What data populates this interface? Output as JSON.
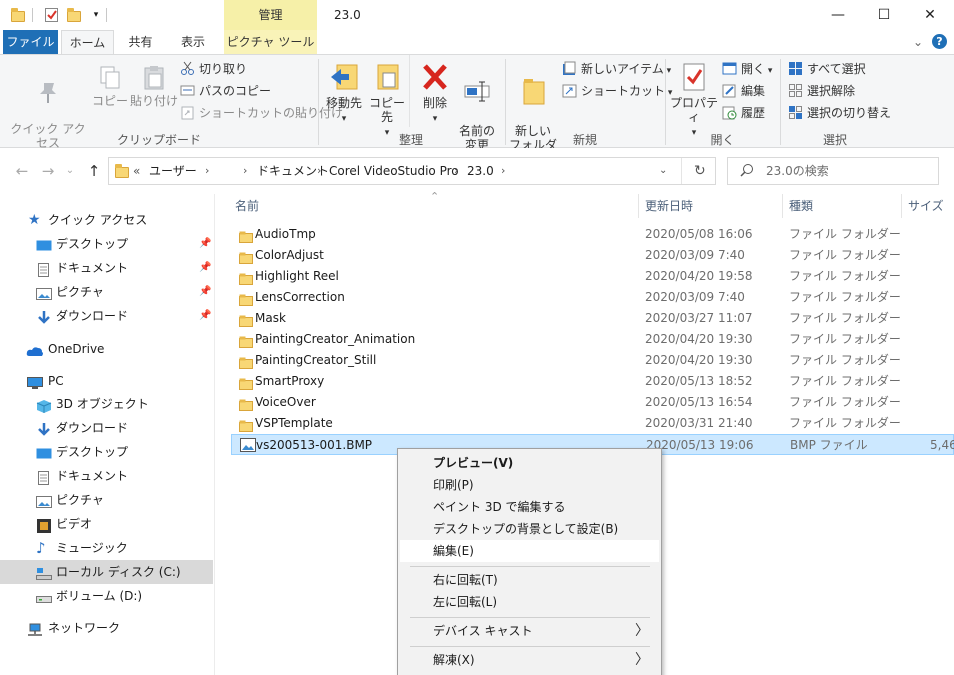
{
  "window": {
    "title": "23.0",
    "manage_tab": "管理",
    "minimize": "—",
    "maximize": "☐",
    "close": "✕"
  },
  "ribbon_tabs": {
    "file": "ファイル",
    "home": "ホーム",
    "share": "共有",
    "view": "表示",
    "picture_tools": "ピクチャ ツール",
    "collapse": "⌄",
    "help": "?"
  },
  "ribbon": {
    "clipboard": {
      "label": "クリップボード",
      "pin_quick_access": "クイック アクセス\nにピン留めする",
      "copy": "コピー",
      "paste": "貼り付け",
      "cut": "切り取り",
      "copy_path": "パスのコピー",
      "paste_shortcut": "ショートカットの貼り付け"
    },
    "organize": {
      "label": "整理",
      "move_to": "移動先",
      "copy_to": "コピー先",
      "delete": "削除",
      "rename": "名前の\n変更"
    },
    "new": {
      "label": "新規",
      "new_folder": "新しい\nフォルダー",
      "new_item": "新しいアイテム",
      "shortcut": "ショートカット"
    },
    "open": {
      "label": "開く",
      "properties": "プロパティ",
      "open": "開く",
      "edit": "編集",
      "history": "履歴"
    },
    "select": {
      "label": "選択",
      "select_all": "すべて選択",
      "select_none": "選択解除",
      "invert": "選択の切り替え"
    }
  },
  "address": {
    "overflow": "«",
    "segments": [
      "ユーザー",
      "",
      "ドキュメント",
      "Corel VideoStudio Pro",
      "23.0"
    ],
    "search_placeholder": "23.0の検索"
  },
  "nav": {
    "quick_access": "クイック アクセス",
    "qa_items": [
      "デスクトップ",
      "ドキュメント",
      "ピクチャ",
      "ダウンロード"
    ],
    "onedrive": "OneDrive",
    "pc": "PC",
    "pc_items": [
      "3D オブジェクト",
      "ダウンロード",
      "デスクトップ",
      "ドキュメント",
      "ピクチャ",
      "ビデオ",
      "ミュージック",
      "ローカル ディスク (C:)",
      "ボリューム (D:)"
    ],
    "network": "ネットワーク"
  },
  "columns": {
    "name": "名前",
    "date": "更新日時",
    "type": "種類",
    "size": "サイズ"
  },
  "files": [
    {
      "name": "AudioTmp",
      "date": "2020/05/08 16:06",
      "type": "ファイル フォルダー",
      "size": ""
    },
    {
      "name": "ColorAdjust",
      "date": "2020/03/09 7:40",
      "type": "ファイル フォルダー",
      "size": ""
    },
    {
      "name": "Highlight Reel",
      "date": "2020/04/20 19:58",
      "type": "ファイル フォルダー",
      "size": ""
    },
    {
      "name": "LensCorrection",
      "date": "2020/03/09 7:40",
      "type": "ファイル フォルダー",
      "size": ""
    },
    {
      "name": "Mask",
      "date": "2020/03/27 11:07",
      "type": "ファイル フォルダー",
      "size": ""
    },
    {
      "name": "PaintingCreator_Animation",
      "date": "2020/04/20 19:30",
      "type": "ファイル フォルダー",
      "size": ""
    },
    {
      "name": "PaintingCreator_Still",
      "date": "2020/04/20 19:30",
      "type": "ファイル フォルダー",
      "size": ""
    },
    {
      "name": "SmartProxy",
      "date": "2020/05/13 18:52",
      "type": "ファイル フォルダー",
      "size": ""
    },
    {
      "name": "VoiceOver",
      "date": "2020/05/13 16:54",
      "type": "ファイル フォルダー",
      "size": ""
    },
    {
      "name": "VSPTemplate",
      "date": "2020/03/31 21:40",
      "type": "ファイル フォルダー",
      "size": ""
    },
    {
      "name": "vs200513-001.BMP",
      "date": "2020/05/13 19:06",
      "type": "BMP ファイル",
      "size": "5,46"
    }
  ],
  "context_menu": {
    "preview": "プレビュー(V)",
    "print": "印刷(P)",
    "paint3d": "ペイント 3D で編集する",
    "set_background": "デスクトップの背景として設定(B)",
    "edit": "編集(E)",
    "rotate_right": "右に回転(T)",
    "rotate_left": "左に回転(L)",
    "cast": "デバイス キャスト",
    "extract": "解凍(X)",
    "submenu_arrow": "〉"
  }
}
